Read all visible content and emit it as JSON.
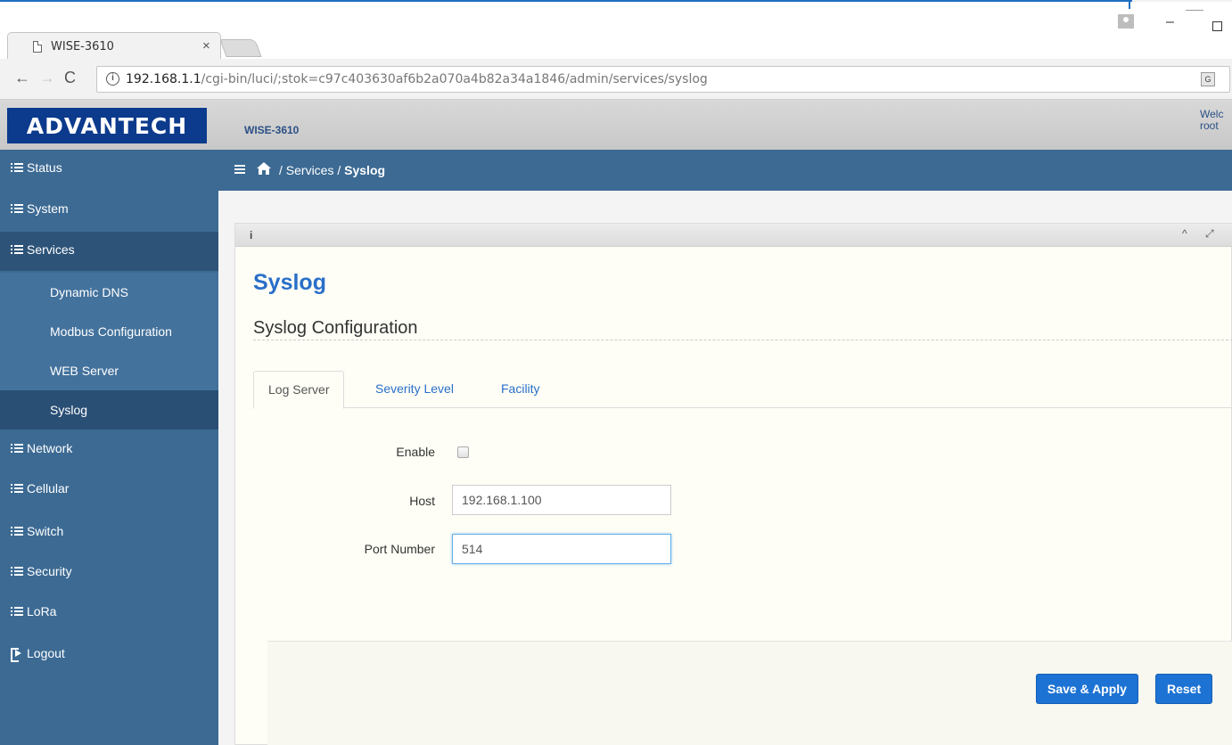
{
  "browser": {
    "tab_title": "WISE-3610",
    "tab_close": "×",
    "url_host": "192.168.1.1",
    "url_path": "/cgi-bin/luci/;stok=c97c403630af6b2a070a4b82a34a1846/admin/services/syslog",
    "url_info_icon": "i",
    "back_glyph": "←",
    "forward_glyph": "→",
    "reload_glyph": "C",
    "minimize_glyph": "–",
    "translate_icon": "G"
  },
  "header": {
    "logo": "ADVANTECH",
    "product": "WISE-3610",
    "welcome": "Welc",
    "user": "root"
  },
  "sidebar": {
    "items": [
      {
        "label": "Status"
      },
      {
        "label": "System"
      },
      {
        "label": "Services"
      },
      {
        "label": "Network"
      },
      {
        "label": "Cellular"
      },
      {
        "label": "Switch"
      },
      {
        "label": "Security"
      },
      {
        "label": "LoRa"
      },
      {
        "label": "Logout"
      }
    ],
    "services_sub": [
      {
        "label": "Dynamic DNS"
      },
      {
        "label": "Modbus Configuration"
      },
      {
        "label": "WEB Server"
      },
      {
        "label": "Syslog"
      }
    ]
  },
  "breadcrumb": {
    "sep1": "/",
    "section": "Services",
    "sep2": "/",
    "current": "Syslog"
  },
  "panel": {
    "info_icon": "i",
    "collapse_icon": "^",
    "expand_icon": "⤢"
  },
  "page": {
    "title": "Syslog",
    "subtitle": "Syslog Configuration",
    "tabs": [
      {
        "label": "Log Server",
        "active": true
      },
      {
        "label": "Severity Level",
        "active": false
      },
      {
        "label": "Facility",
        "active": false
      }
    ],
    "form": {
      "enable_label": "Enable",
      "enable_checked": false,
      "host_label": "Host",
      "host_value": "192.168.1.100",
      "port_label": "Port Number",
      "port_value": "514"
    },
    "buttons": {
      "save": "Save & Apply",
      "reset": "Reset"
    }
  },
  "colors": {
    "sidebar_bg": "#3c6a93",
    "accent": "#1d73d4",
    "title": "#2a6fc9",
    "logo_bg": "#0c3a8c"
  }
}
